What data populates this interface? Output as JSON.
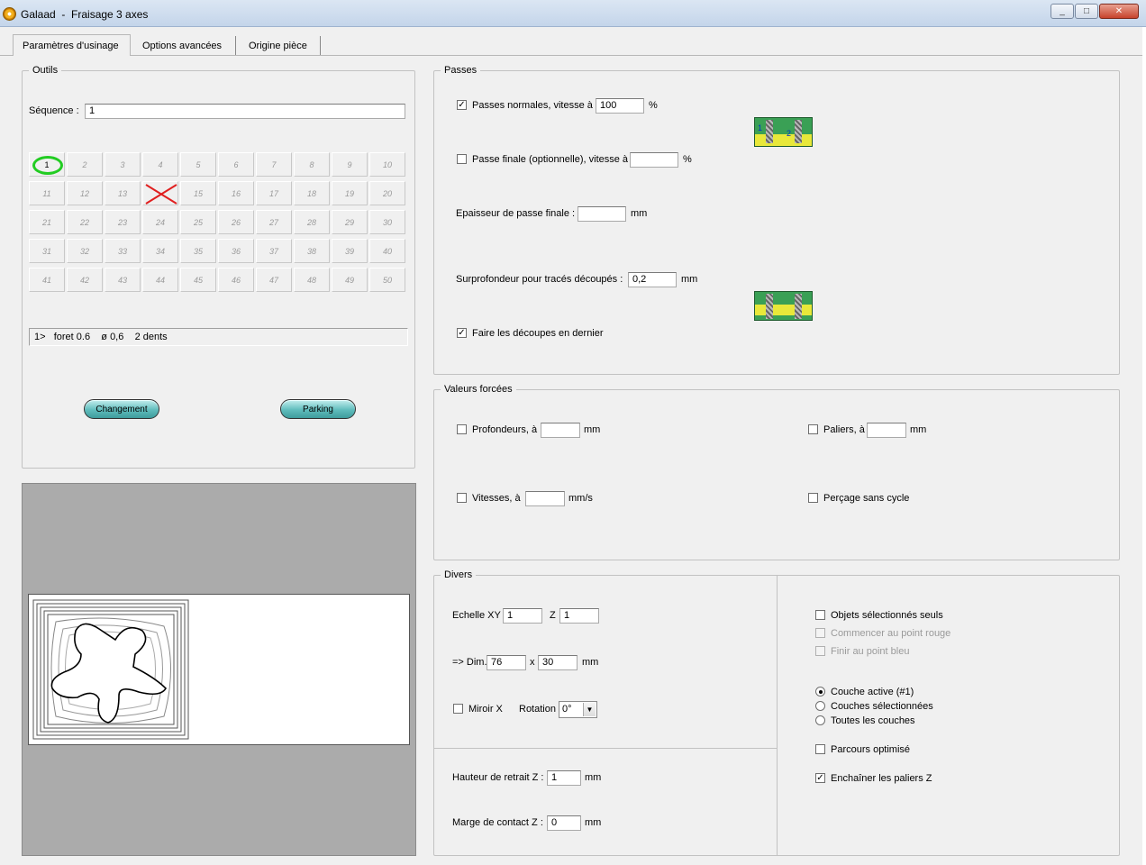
{
  "window": {
    "title": "Galaad  -  Fraisage 3 axes",
    "minimize": "_",
    "maximize": "□",
    "close": "✕"
  },
  "tabs": [
    "Paramètres d'usinage",
    "Options avancées",
    "Origine pièce"
  ],
  "outils": {
    "label": "Outils",
    "sequence_label": "Séquence :",
    "sequence_value": "1",
    "tools": [
      "1",
      "2",
      "3",
      "4",
      "5",
      "6",
      "7",
      "8",
      "9",
      "10",
      "11",
      "12",
      "13",
      "14",
      "15",
      "16",
      "17",
      "18",
      "19",
      "20",
      "21",
      "22",
      "23",
      "24",
      "25",
      "26",
      "27",
      "28",
      "29",
      "30",
      "31",
      "32",
      "33",
      "34",
      "35",
      "36",
      "37",
      "38",
      "39",
      "40",
      "41",
      "42",
      "43",
      "44",
      "45",
      "46",
      "47",
      "48",
      "49",
      "50"
    ],
    "selected_tool": "1",
    "disabled_tool": "14",
    "status": "1>   foret 0.6    ø 0,6    2 dents",
    "change_button": "Changement",
    "parking_button": "Parking"
  },
  "passes": {
    "label": "Passes",
    "normal_label": "Passes normales, vitesse à",
    "normal_value": "100",
    "normal_checked": true,
    "percent": "%",
    "final_label": "Passe finale (optionnelle), vitesse à",
    "final_value": "",
    "final_checked": false,
    "thickness_label": "Epaisseur de passe finale :",
    "thickness_value": "",
    "mm": "mm",
    "depth_label": "Surprofondeur pour tracés découpés :",
    "depth_value": "0,2",
    "cuts_last_label": "Faire les découpes en dernier",
    "cuts_last_checked": true,
    "img_pass1": "1",
    "img_pass2": "2"
  },
  "forced": {
    "label": "Valeurs forcées",
    "depths_label": "Profondeurs, à",
    "depths_value": "",
    "steps_label": "Paliers, à",
    "steps_value": "",
    "speeds_label": "Vitesses, à",
    "speeds_value": "",
    "speeds_unit": "mm/s",
    "drill_label": "Perçage sans cycle",
    "mm": "mm"
  },
  "divers": {
    "label": "Divers",
    "scale_label": "Echelle XY",
    "scale_xy": "1",
    "z_label": "Z",
    "scale_z": "1",
    "dim_label": "=> Dim.",
    "dim_x": "76",
    "x_sep": "x",
    "dim_y": "30",
    "mm": "mm",
    "mirror_label": "Miroir X",
    "rotation_label": "Rotation",
    "rotation_value": "0°",
    "retract_label": "Hauteur de retrait Z :",
    "retract_value": "1",
    "contact_label": "Marge de contact Z :",
    "contact_value": "0",
    "selected_only": "Objets sélectionnés seuls",
    "start_red": "Commencer au point rouge",
    "end_blue": "Finir au point bleu",
    "layer_active": "Couche active (#1)",
    "layers_selected": "Couches sélectionnées",
    "layers_all": "Toutes les couches",
    "optimized": "Parcours optimisé",
    "chain_steps": "Enchaîner les paliers Z",
    "chain_checked": true
  },
  "colors": {
    "accent_teal": "#5fbcbc",
    "selected_tool_ring": "#22cc22",
    "disabled_cross": "#e02020"
  }
}
